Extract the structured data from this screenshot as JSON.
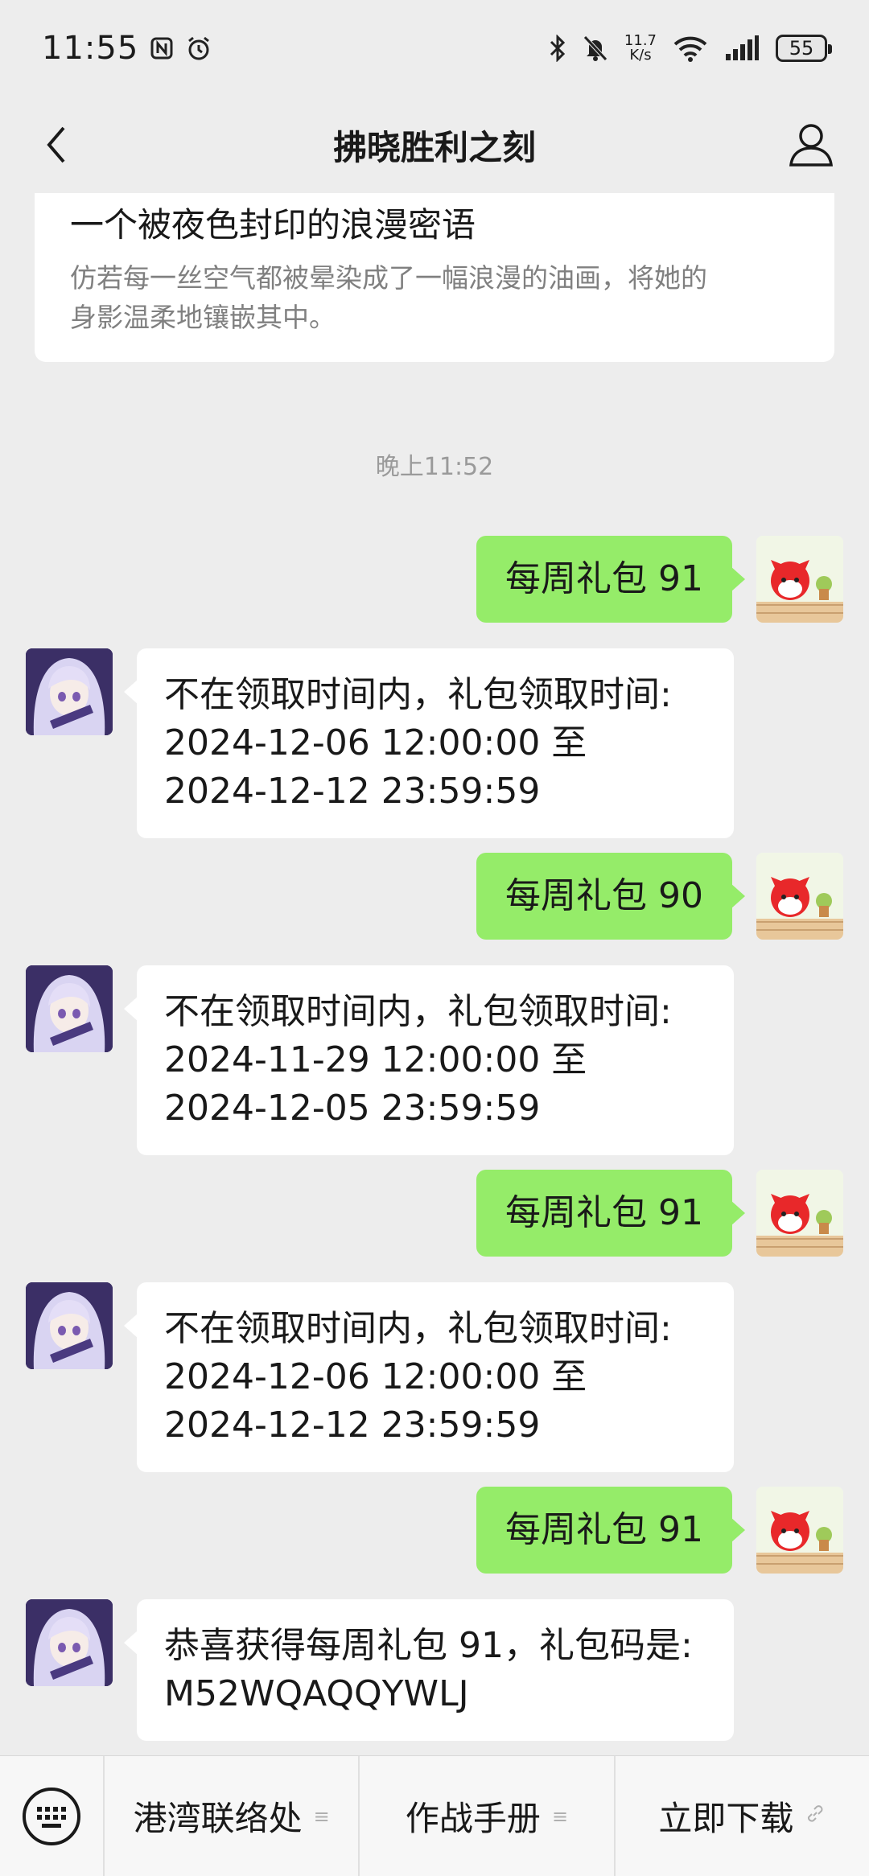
{
  "status_bar": {
    "time": "11:55",
    "net_speed_value": "11.7",
    "net_speed_unit": "K/s",
    "battery": "55"
  },
  "nav": {
    "title": "拂晓胜利之刻"
  },
  "article": {
    "title": "一个被夜色封印的浪漫密语",
    "desc_line1": "仿若每一丝空气都被晕染成了一幅浪漫的油画，将她的",
    "desc_line2": "身影温柔地镶嵌其中。"
  },
  "timestamp": "晚上11:52",
  "messages": [
    {
      "dir": "out",
      "text": "每周礼包 91"
    },
    {
      "dir": "in",
      "lines": [
        "不在领取时间内，礼包领取时间:",
        "2024-12-06 12:00:00 至",
        "2024-12-12 23:59:59"
      ]
    },
    {
      "dir": "out",
      "text": "每周礼包 90"
    },
    {
      "dir": "in",
      "lines": [
        "不在领取时间内，礼包领取时间:",
        "2024-11-29 12:00:00 至",
        "2024-12-05 23:59:59"
      ]
    },
    {
      "dir": "out",
      "text": "每周礼包 91"
    },
    {
      "dir": "in",
      "lines": [
        "不在领取时间内，礼包领取时间:",
        "2024-12-06 12:00:00 至",
        "2024-12-12 23:59:59"
      ]
    },
    {
      "dir": "out",
      "text": "每周礼包 91"
    },
    {
      "dir": "in",
      "lines": [
        "恭喜获得每周礼包 91，礼包码是:",
        "M52WQAQQYWLJ"
      ]
    }
  ],
  "menu": {
    "items": [
      {
        "label": "港湾联络处",
        "icon": "menu-lines-icon"
      },
      {
        "label": "作战手册",
        "icon": "menu-lines-icon"
      },
      {
        "label": "立即下载",
        "icon": "link-icon"
      }
    ]
  },
  "colors": {
    "background": "#ededed",
    "outgoing_bubble": "#95ec69",
    "incoming_bubble": "#ffffff"
  }
}
